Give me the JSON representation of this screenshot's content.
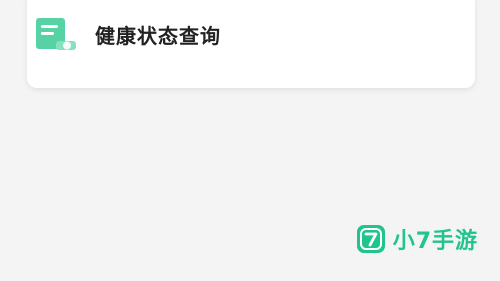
{
  "menu": {
    "health_status_query_label": "健康状态查询",
    "icon": "document-search-icon"
  },
  "watermark": {
    "badge_text": "7",
    "brand_text": "小7手游",
    "color": "#21c48d"
  },
  "colors": {
    "background": "#f4f4f4",
    "card": "#ffffff",
    "icon_accent": "#57d2a5",
    "icon_secondary": "#89e0c0"
  }
}
